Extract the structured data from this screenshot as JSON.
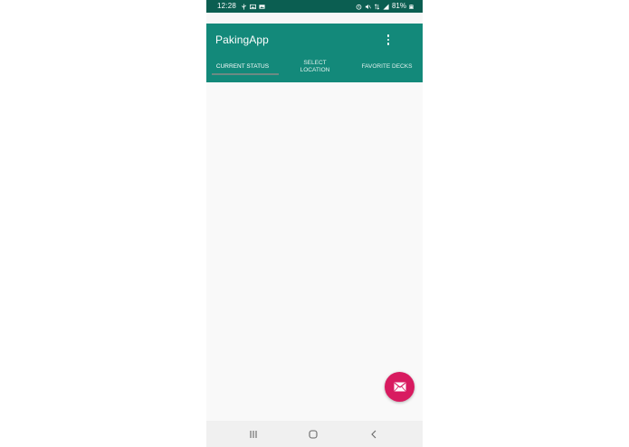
{
  "status_bar": {
    "time": "12:28",
    "battery": "81%",
    "bg_color": "#0b5e51"
  },
  "app_bar": {
    "title": "PakingApp",
    "menu_icon": "more-vertical-icon",
    "bg_color": "#13897a"
  },
  "tabs": [
    {
      "label": "CURRENT STATUS",
      "selected": true
    },
    {
      "label": "SELECT LOCATION",
      "selected": false
    },
    {
      "label": "FAVORITE DECKS",
      "selected": false
    }
  ],
  "fab": {
    "icon": "mail-icon",
    "color": "#d81b60"
  },
  "nav_bar": {
    "recents_icon": "recents-icon",
    "home_icon": "home-icon",
    "back_icon": "back-icon"
  }
}
